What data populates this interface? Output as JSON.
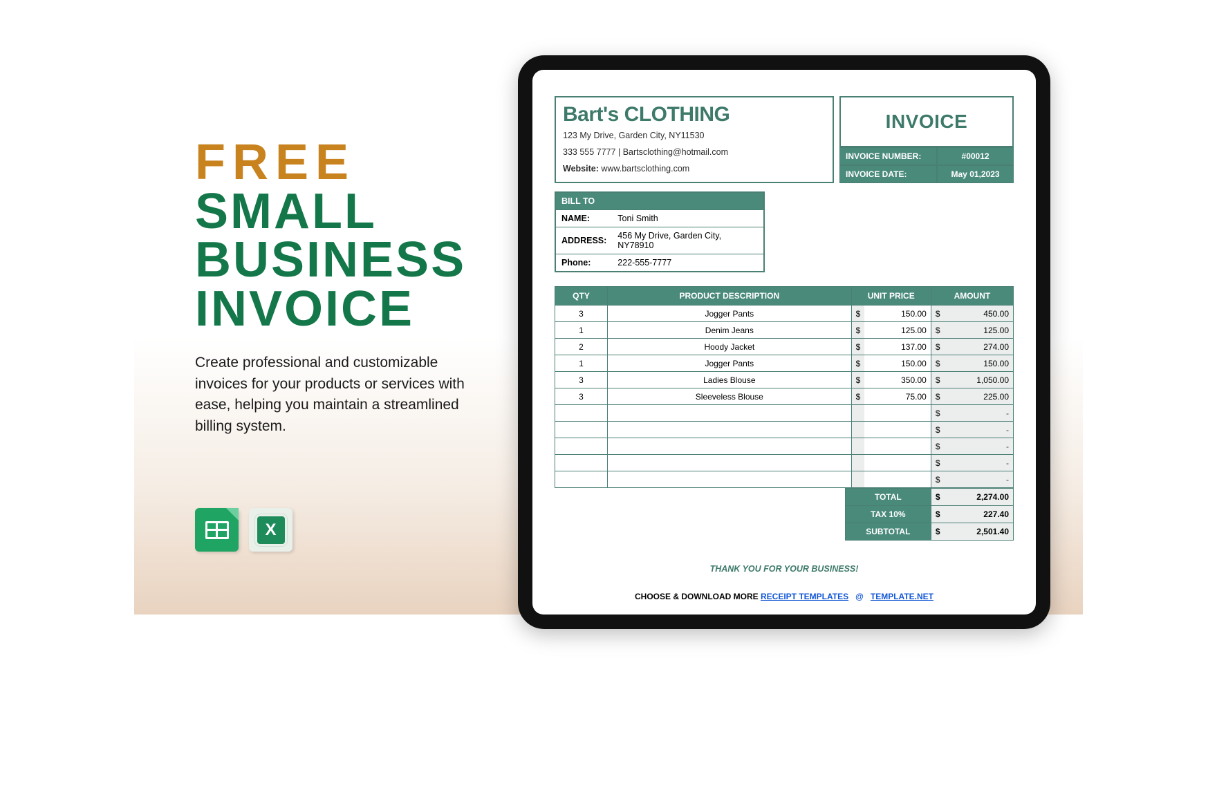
{
  "promo": {
    "title_free": "FREE",
    "title_main": "SMALL BUSINESS INVOICE",
    "subtitle": "Create professional and customizable invoices for your products or services with ease, helping you maintain a streamlined billing system."
  },
  "invoice": {
    "title": "INVOICE",
    "currency": "$",
    "company": {
      "name": "Bart's CLOTHING",
      "address": "123 My Drive, Garden City, NY11530",
      "phone": "333 555 7777",
      "email": "Bartsclothing@hotmail.com",
      "website_label": "Website:",
      "website": "www.bartsclothing.com"
    },
    "meta": {
      "number_label": "INVOICE NUMBER:",
      "number": "#00012",
      "date_label": "INVOICE DATE:",
      "date": "May 01,2023"
    },
    "bill_to": {
      "header": "BILL TO",
      "name_label": "NAME:",
      "name": "Toni Smith",
      "address_label": "ADDRESS:",
      "address": "456 My Drive, Garden City, NY78910",
      "phone_label": "Phone:",
      "phone": "222-555-7777"
    },
    "columns": {
      "qty": "QTY",
      "desc": "PRODUCT DESCRIPTION",
      "unit": "UNIT PRICE",
      "amount": "AMOUNT"
    },
    "items": [
      {
        "qty": "3",
        "desc": "Jogger Pants",
        "unit": "150.00",
        "amount": "450.00"
      },
      {
        "qty": "1",
        "desc": "Denim Jeans",
        "unit": "125.00",
        "amount": "125.00"
      },
      {
        "qty": "2",
        "desc": "Hoody Jacket",
        "unit": "137.00",
        "amount": "274.00"
      },
      {
        "qty": "1",
        "desc": "Jogger Pants",
        "unit": "150.00",
        "amount": "150.00"
      },
      {
        "qty": "3",
        "desc": "Ladies Blouse",
        "unit": "350.00",
        "amount": "1,050.00"
      },
      {
        "qty": "3",
        "desc": "Sleeveless Blouse",
        "unit": "75.00",
        "amount": "225.00"
      },
      {
        "qty": "",
        "desc": "",
        "unit": "",
        "amount": "-"
      },
      {
        "qty": "",
        "desc": "",
        "unit": "",
        "amount": "-"
      },
      {
        "qty": "",
        "desc": "",
        "unit": "",
        "amount": "-"
      },
      {
        "qty": "",
        "desc": "",
        "unit": "",
        "amount": "-"
      },
      {
        "qty": "",
        "desc": "",
        "unit": "",
        "amount": "-"
      }
    ],
    "totals": {
      "total_label": "TOTAL",
      "total": "2,274.00",
      "tax_label": "TAX  10%",
      "tax": "227.40",
      "subtotal_label": "SUBTOTAL",
      "subtotal": "2,501.40"
    },
    "thank_you": "THANK YOU FOR YOUR BUSINESS!"
  },
  "footer": {
    "prefix": "CHOOSE & DOWNLOAD MORE ",
    "link1": "RECEIPT TEMPLATES",
    "at": "@",
    "link2": "TEMPLATE.NET"
  }
}
